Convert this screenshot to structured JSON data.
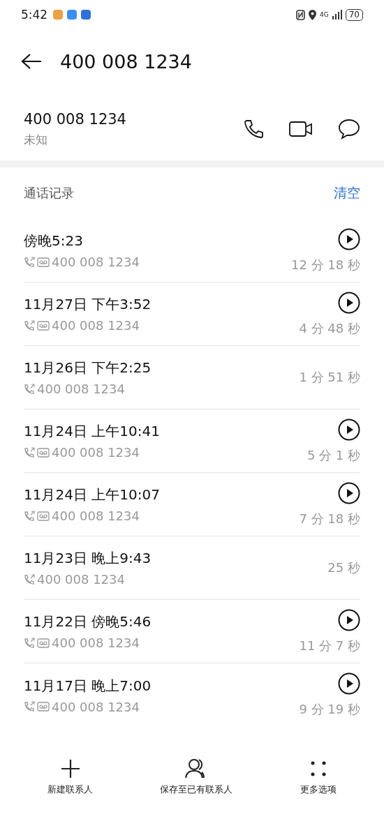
{
  "status_bar": {
    "time": "5:42",
    "battery": "70",
    "network": "4G"
  },
  "header": {
    "title": "400 008 1234"
  },
  "contact": {
    "number": "400 008 1234",
    "label": "未知"
  },
  "call_log": {
    "title": "通话记录",
    "clear": "清空",
    "rows": [
      {
        "time": "傍晚5:23",
        "number": "400 008 1234",
        "duration": "12 分 18 秒",
        "recorded": true
      },
      {
        "time": "11月27日 下午3:52",
        "number": "400 008 1234",
        "duration": "4 分 48 秒",
        "recorded": true
      },
      {
        "time": "11月26日 下午2:25",
        "number": "400 008 1234",
        "duration": "1 分 51 秒",
        "recorded": false
      },
      {
        "time": "11月24日 上午10:41",
        "number": "400 008 1234",
        "duration": "5 分 1 秒",
        "recorded": true
      },
      {
        "time": "11月24日 上午10:07",
        "number": "400 008 1234",
        "duration": "7 分 18 秒",
        "recorded": true
      },
      {
        "time": "11月23日 晚上9:43",
        "number": "400 008 1234",
        "duration": "25 秒",
        "recorded": false
      },
      {
        "time": "11月22日 傍晚5:46",
        "number": "400 008 1234",
        "duration": "11 分 7 秒",
        "recorded": true
      },
      {
        "time": "11月17日 晚上7:00",
        "number": "400 008 1234",
        "duration": "9 分 19 秒",
        "recorded": true
      }
    ]
  },
  "bottom_bar": [
    {
      "kind": "add",
      "label": "新建联系人"
    },
    {
      "kind": "person",
      "label": "保存至已有联系人"
    },
    {
      "kind": "more",
      "label": "更多选项"
    }
  ]
}
